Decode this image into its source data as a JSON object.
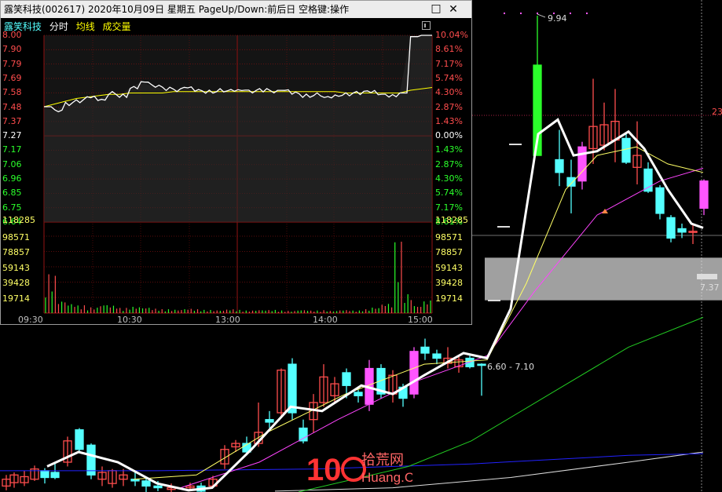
{
  "window": {
    "title": "露笑科技(002617) 2020年10月09日 星期五 PageUp/Down:前后日 空格键:操作",
    "minimize_glyph": "□",
    "close_glyph": "✕"
  },
  "legend": {
    "name": "露笑科技",
    "item_minute": "分时",
    "item_avg": "均线",
    "item_volume": "成交量"
  },
  "price_axis": {
    "left": [
      "8.00",
      "7.90",
      "7.79",
      "7.69",
      "7.58",
      "7.48",
      "7.37",
      "7.27",
      "7.17",
      "7.06",
      "6.96",
      "6.85",
      "6.75",
      "6.64"
    ],
    "right": [
      "10.04%",
      "8.61%",
      "7.17%",
      "5.74%",
      "4.30%",
      "2.87%",
      "1.43%",
      "0.00%",
      "1.43%",
      "2.87%",
      "4.30%",
      "5.74%",
      "7.17%",
      "8.61%"
    ]
  },
  "volume_axis": {
    "left": [
      "118285",
      "98571",
      "78857",
      "59143",
      "39428",
      "19714"
    ],
    "right": [
      "118285",
      "98571",
      "78857",
      "59143",
      "39428",
      "19714"
    ]
  },
  "time_axis": [
    "09:30",
    "10:30",
    "13:00",
    "14:00",
    "15:00"
  ],
  "kline_labels": {
    "high": "9.94",
    "range": "6.60 - 7.10",
    "current": "7.37",
    "edge_number": "23"
  },
  "watermark": {
    "cn": "拾荒网",
    "num": "10",
    "en": "Huang.CN"
  },
  "colors": {
    "up": "#ff4d4d",
    "down": "#54ffff",
    "limit_up": "#2bff2b",
    "magenta": "#ff55ff",
    "ma5": "#ffffff",
    "ma10": "#ffff66",
    "ma20": "#ff44ff",
    "ma60": "#22cc22",
    "ma120": "#2222ff",
    "ma250": "#dddddd",
    "price_line": "#ffffff",
    "avg_line": "#ffff00",
    "grid": "#7a1010"
  },
  "chart_data": {
    "type": "line",
    "title": "露笑科技(002617) 2020年10月09日",
    "preclose": 7.27,
    "ylim": [
      6.64,
      8.0
    ],
    "price_series": [
      7.48,
      7.45,
      7.5,
      7.52,
      7.55,
      7.53,
      7.58,
      7.56,
      7.62,
      7.66,
      7.63,
      7.61,
      7.6,
      7.62,
      7.6,
      7.59,
      7.6,
      7.6,
      7.6,
      7.59,
      7.6,
      7.59,
      7.6,
      7.58,
      7.56,
      7.57,
      7.55,
      7.56,
      7.57,
      7.58,
      7.59,
      7.57,
      7.56,
      7.58,
      7.99,
      8.0,
      8.0
    ],
    "avg_series": [
      7.48,
      7.5,
      7.52,
      7.54,
      7.55,
      7.56,
      7.57,
      7.57,
      7.58,
      7.58,
      7.58,
      7.58,
      7.59,
      7.59,
      7.59,
      7.59,
      7.59,
      7.59,
      7.59,
      7.59,
      7.59,
      7.59,
      7.59,
      7.59,
      7.59,
      7.59,
      7.59,
      7.59,
      7.58,
      7.58,
      7.58,
      7.58,
      7.58,
      7.58,
      7.6,
      7.61,
      7.62
    ],
    "volume_ylim": [
      0,
      118285
    ],
    "volume_series": [
      60000,
      20000,
      15000,
      12000,
      9000,
      14000,
      12000,
      8000,
      10000,
      9000,
      7000,
      6000,
      5500,
      7000,
      6000,
      5000,
      4500,
      6000,
      5000,
      4000,
      5000,
      5000,
      4000,
      3500,
      5000,
      4000,
      4500,
      3500,
      5000,
      4000,
      6000,
      9000,
      15000,
      110000,
      30000,
      12000,
      20000
    ]
  }
}
